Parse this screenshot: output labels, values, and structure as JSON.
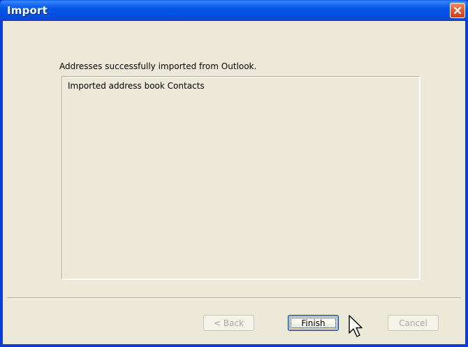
{
  "window": {
    "title": "Import",
    "close_icon": "close-icon"
  },
  "content": {
    "message": "Addresses successfully imported from Outlook.",
    "log_items": [
      "Imported address book Contacts"
    ]
  },
  "buttons": {
    "back_label": "< Back",
    "finish_label": "Finish",
    "cancel_label": "Cancel"
  },
  "colors": {
    "titlebar": "#0054e3",
    "dialog_bg": "#ece9d8",
    "close": "#e25b2f"
  }
}
